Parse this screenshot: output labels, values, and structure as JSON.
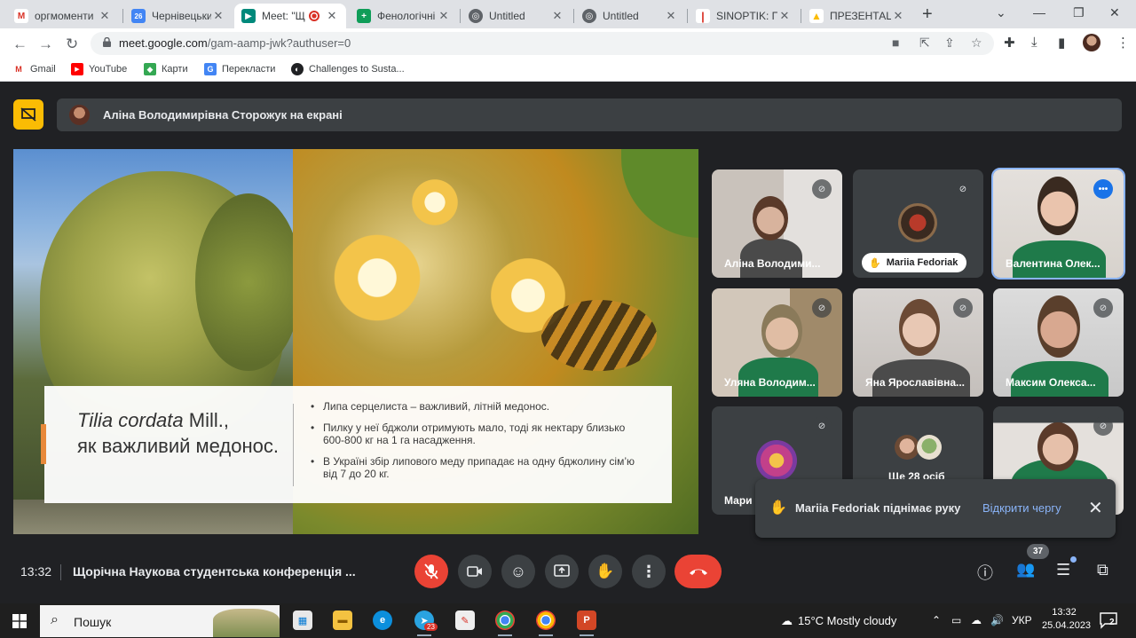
{
  "browser": {
    "tabs": [
      {
        "title": "оргмоменти",
        "color": "#d93025",
        "glyph": "M",
        "active": false
      },
      {
        "title": "Чернівецький",
        "color": "#4285f4",
        "glyph": "26",
        "active": false
      },
      {
        "title": "Meet: \"Щ",
        "color": "#00897b",
        "glyph": "▶",
        "active": true
      },
      {
        "title": "Фенологічні",
        "color": "#0f9d58",
        "glyph": "+",
        "active": false
      },
      {
        "title": "Untitled",
        "color": "#5f6368",
        "glyph": "◎",
        "active": false
      },
      {
        "title": "Untitled",
        "color": "#5f6368",
        "glyph": "◎",
        "active": false
      },
      {
        "title": "SINOPTIK: По",
        "color": "#d93025",
        "glyph": "|",
        "active": false
      },
      {
        "title": "ПРЕЗЕНТАЦІ",
        "color": "#fbbc04",
        "glyph": "▲",
        "active": false
      }
    ],
    "url_host": "meet.google.com",
    "url_path": "/gam-aamp-jwk?authuser=0",
    "bookmarks": [
      {
        "label": "Gmail",
        "color": "#d93025",
        "glyph": "M"
      },
      {
        "label": "YouTube",
        "color": "#ff0000",
        "glyph": "▶"
      },
      {
        "label": "Карти",
        "color": "#34a853",
        "glyph": "◆"
      },
      {
        "label": "Перекласти",
        "color": "#4285f4",
        "glyph": "G"
      },
      {
        "label": "Challenges to Susta...",
        "color": "#202124",
        "glyph": "◐"
      }
    ]
  },
  "meet": {
    "presenting_text": "Аліна Володимирівна Сторожук на екрані",
    "slide": {
      "species_latin": "Tilia cordata",
      "species_author": " Mill.,",
      "species_rest": "як важливий медонос.",
      "bullets": [
        "Липа серцелиста – важливий,  літній медонос.",
        "Пилку у неї бджоли отримують мало, тоді як нектару близько 600-800 кг на 1 га насадження.",
        "В Україні збір липового меду припадає на одну бджолину сім’ю від 7 до 20 кг."
      ]
    },
    "participants": [
      {
        "name": "Аліна Володими...",
        "state": "muted"
      },
      {
        "name": "Mariia Fedoriak",
        "state": "muted-hand"
      },
      {
        "name": "Валентина Олек...",
        "state": "speaking"
      },
      {
        "name": "Уляна Володим...",
        "state": "muted"
      },
      {
        "name": "Яна Ярославівна...",
        "state": "muted"
      },
      {
        "name": "Максим Олекса...",
        "state": "muted"
      },
      {
        "name": "Мари",
        "state": "muted"
      },
      {
        "name": "Ще 28 осіб",
        "state": "more"
      },
      {
        "name": "",
        "state": "muted"
      }
    ],
    "toast": {
      "message": "Mariia Fedoriak піднімає руку",
      "action": "Відкрити чергу"
    },
    "clock": "13:32",
    "meeting_title": "Щорічна Наукова студентська конференція ...",
    "participants_count": "37"
  },
  "taskbar": {
    "search_placeholder": "Пошук",
    "telegram_badge": "23",
    "weather": "15°C  Mostly cloudy",
    "language": "УКР",
    "time": "13:32",
    "date": "25.04.2023",
    "notifications": "2"
  }
}
